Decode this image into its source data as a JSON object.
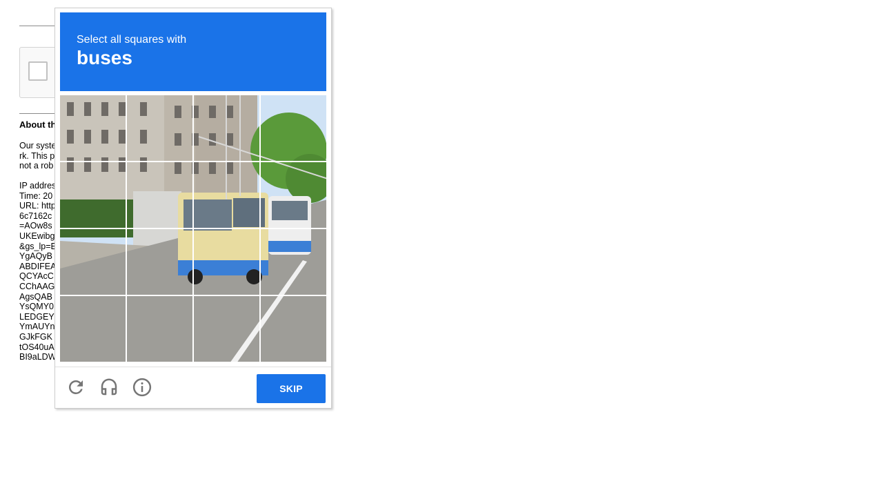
{
  "background_page": {
    "about_title": "About th",
    "para_lines": [
      "Our syste",
      "rk. This p",
      "not a rob"
    ],
    "info_lines": [
      "IP addres",
      "Time: 20",
      "URL: http",
      "6c7162c",
      "=AOw8s",
      "UKEwibg",
      "&gs_lp=E",
      "YgAQyB",
      "ABDIFEA",
      "QCYAcC",
      "CChAAG",
      "AgsQAB",
      "YsQMY0",
      "LEDGEY",
      "YmAUYn",
      "GJkFGK",
      "tOS40uA",
      "BI9aLDW"
    ]
  },
  "challenge": {
    "instruction": "Select all squares with",
    "target": "buses",
    "skip_label": "SKIP",
    "icons": [
      "reload-icon",
      "audio-headphones-icon",
      "info-icon"
    ],
    "tile_count": 16,
    "colors": {
      "header": "#1a73e8",
      "button": "#1a73e8"
    }
  }
}
